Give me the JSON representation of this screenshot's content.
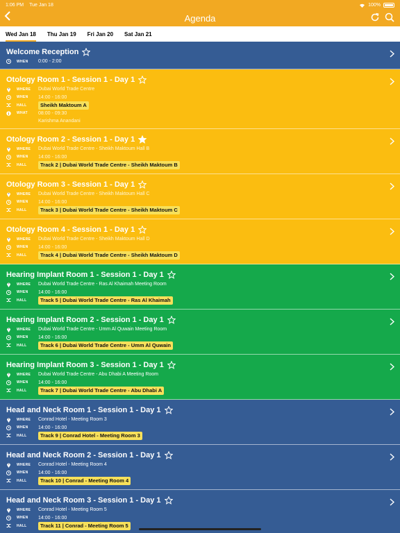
{
  "status": {
    "time": "1:06 PM",
    "date": "Tue Jan 18",
    "battery": "100%"
  },
  "nav": {
    "title": "Agenda",
    "back_icon": "chevron-left-icon",
    "refresh_icon": "refresh-icon",
    "search_icon": "search-icon"
  },
  "tabs": [
    {
      "label": "Wed Jan 18",
      "active": true
    },
    {
      "label": "Thu Jan 19",
      "active": false
    },
    {
      "label": "Fri Jan 20",
      "active": false
    },
    {
      "label": "Sat Jan 21",
      "active": false
    }
  ],
  "labels": {
    "where": "WHERE",
    "when": "WHEN",
    "hall": "HALL",
    "what": "WHAT"
  },
  "colors": {
    "header": "#f2a922",
    "orange": "#fbbd10",
    "green": "#15a94b",
    "blue": "#355c94",
    "hall_tag": "#f7e05a"
  },
  "sessions": [
    {
      "title": "Welcome Reception",
      "color": "blue",
      "starred": false,
      "where": "",
      "when": "0:00 - 2:00",
      "hall": "",
      "what": "",
      "speaker": ""
    },
    {
      "title": "Otology Room 1 - Session 1 - Day 1",
      "color": "orange",
      "starred": false,
      "where": "Dubai World Trade Centre",
      "when": "14:00 - 16:00",
      "hall": "Sheikh Maktoum A",
      "what": "08:00 - 09:30",
      "speaker": "Karishma Anandani"
    },
    {
      "title": "Otology Room 2 - Session 1 - Day 1",
      "color": "orange",
      "starred": true,
      "where": "Dubai World Trade Centre - Sheikh Maktoum Hall B",
      "when": "14:00 - 16:00",
      "hall": "Track 2 | Dubai World Trade Centre - Sheikh Maktoum B",
      "what": "",
      "speaker": ""
    },
    {
      "title": "Otology Room 3 - Session 1 - Day 1",
      "color": "orange",
      "starred": false,
      "where": "Dubai World Trade Centre - Sheikh Maktoum Hall C",
      "when": "14:00 - 16:00",
      "hall": "Track 3 | Dubai World Trade Centre - Sheikh Maktoum C",
      "what": "",
      "speaker": ""
    },
    {
      "title": "Otology Room 4 - Session 1 - Day 1",
      "color": "orange",
      "starred": false,
      "where": "Dubai World Trade Centre - Sheikh Maktoum Hall D",
      "when": "14:00 - 16:00",
      "hall": "Track 4 | Dubai World Trade Centre - Sheikh Maktoum D",
      "what": "",
      "speaker": ""
    },
    {
      "title": "Hearing Implant Room 1 - Session 1 - Day 1",
      "color": "green",
      "starred": false,
      "where": "Dubai World Trade Centre - Ras Al Khaimah Meeting Room",
      "when": "14:00 - 16:00",
      "hall": "Track 5 | Dubai World Trade Centre - Ras Al Khaimah",
      "what": "",
      "speaker": ""
    },
    {
      "title": "Hearing Implant Room 2 - Session 1 - Day 1",
      "color": "green",
      "starred": false,
      "where": "Dubai World Trade Centre - Umm Al Quwain Meeting Room",
      "when": "14:00 - 16:00",
      "hall": "Track 6 | Dubai World Trade Centre - Umm Al Quwain",
      "what": "",
      "speaker": ""
    },
    {
      "title": "Hearing Implant Room 3 - Session 1 - Day 1",
      "color": "green",
      "starred": false,
      "where": "Dubai World Trade Centre - Abu Dhabi A Meeting Room",
      "when": "14:00 - 16:00",
      "hall": "Track 7 | Dubai World Trade Centre - Abu Dhabi A",
      "what": "",
      "speaker": ""
    },
    {
      "title": "Head and Neck Room 1 - Session 1 - Day 1",
      "color": "blue",
      "starred": false,
      "where": "Conrad Hotel - Meeting Room 3",
      "when": "14:00 - 16:00",
      "hall": "Track 9 | Conrad Hotel - Meeting Room 3",
      "what": "",
      "speaker": ""
    },
    {
      "title": "Head and Neck Room 2 - Session 1 - Day 1",
      "color": "blue",
      "starred": false,
      "where": "Conrad Hotel - Meeting Room 4",
      "when": "14:00 - 16:00",
      "hall": "Track 10 | Conrad - Meeting Room 4",
      "what": "",
      "speaker": ""
    },
    {
      "title": "Head and Neck Room 3 - Session 1 - Day 1",
      "color": "blue",
      "starred": false,
      "where": "Conrad Hotel - Meeting Room 5",
      "when": "14:00 - 16:00",
      "hall": "Track 11 | Conrad - Meeting Room 5",
      "what": "",
      "speaker": ""
    }
  ]
}
